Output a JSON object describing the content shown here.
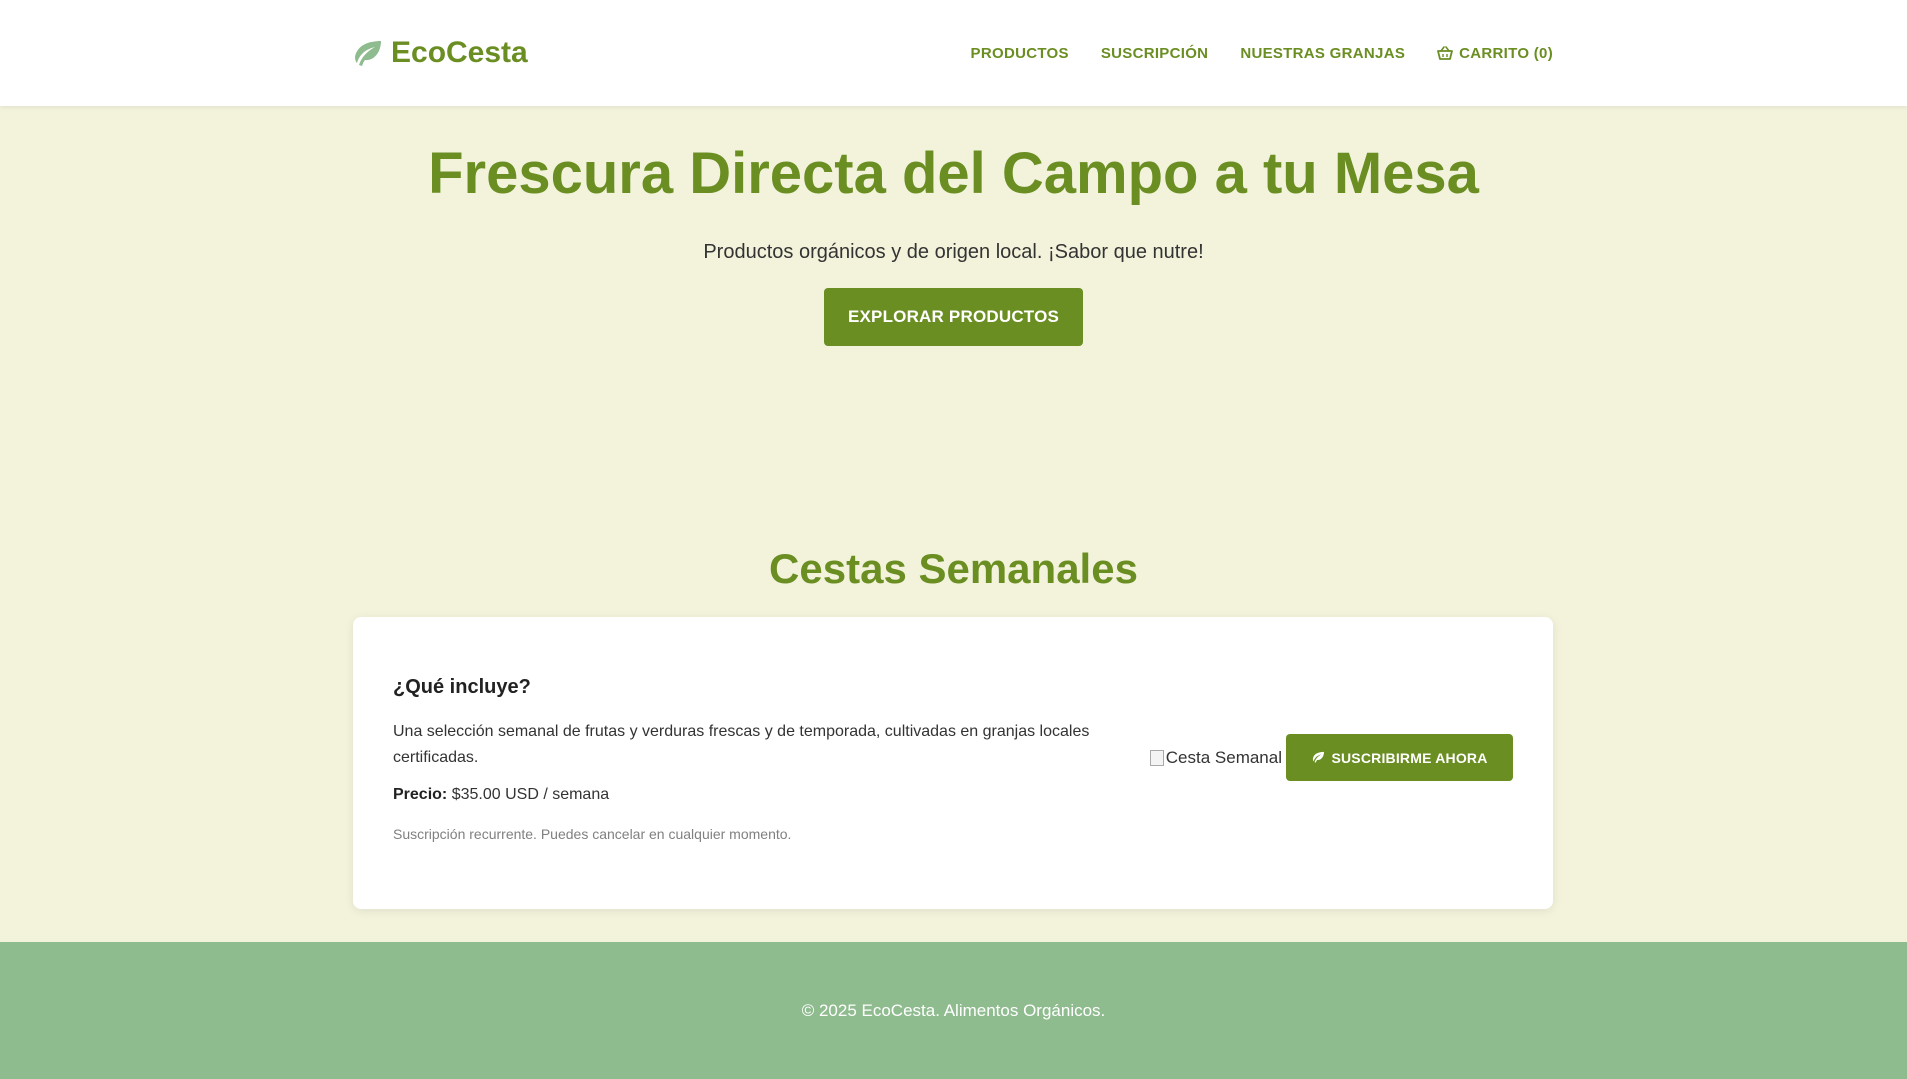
{
  "header": {
    "brand": "EcoCesta",
    "logo_icon": "leaf-icon",
    "nav": [
      {
        "label": "PRODUCTOS"
      },
      {
        "label": "SUSCRIPCIÓN"
      },
      {
        "label": "NUESTRAS GRANJAS"
      },
      {
        "label": "CARRITO (0)",
        "icon": "basket-icon"
      }
    ]
  },
  "hero": {
    "title": "Frescura Directa del Campo a tu Mesa",
    "tagline": "Productos orgánicos y de origen local. ¡Sabor que nutre!",
    "cta_label": "EXPLORAR PRODUCTOS"
  },
  "section": {
    "title": "Cestas Semanales"
  },
  "card": {
    "heading": "¿Qué incluye?",
    "description": "Una selección semanal de frutas y verduras frescas y de temporada, cultivadas en granjas locales certificadas.",
    "price_label": "Precio:",
    "price_value": "$35.00 USD / semana",
    "note": "Suscripción recurrente. Puedes cancelar en cualquier momento.",
    "image_alt": "Cesta Semanal",
    "button_label": "SUSCRIBIRME AHORA",
    "button_icon": "leaf-icon"
  },
  "footer": {
    "text": "© 2025 EcoCesta. Alimentos Orgánicos."
  },
  "colors": {
    "accent": "#6b8e23",
    "background": "#f3f3dc",
    "footer_bg": "#8fbc8f",
    "logo_leaf": "#8fbc8f"
  }
}
